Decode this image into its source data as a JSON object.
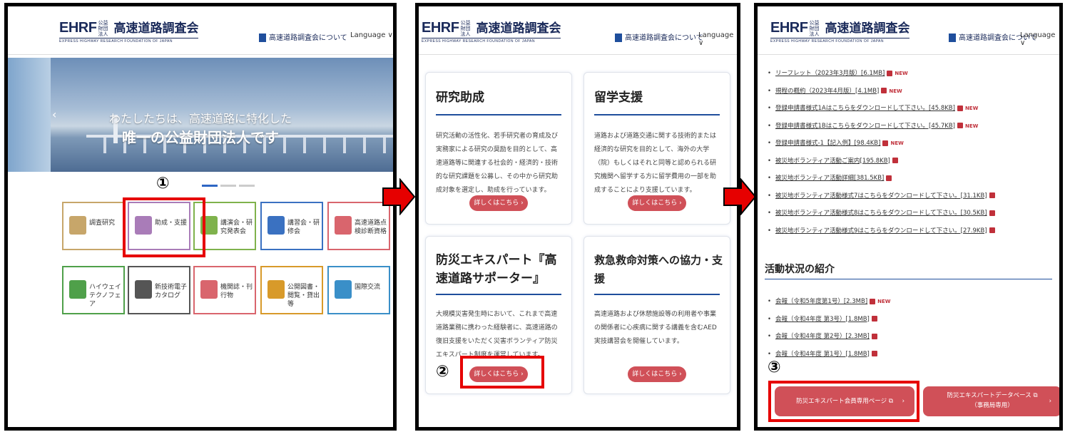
{
  "header": {
    "logo_main": "EHRF",
    "logo_corp": "公益 財団法人",
    "logo_jp": "高速道路調査会",
    "logo_en": "EXPRESS HIGHWAY RESEARCH FOUNDATION OF JAPAN",
    "about_link": "高速道路調査会について",
    "language": "Language ∨"
  },
  "hero": {
    "line1": "わたしたちは、高速道路に特化した",
    "line2": "唯一の公益財団法人です"
  },
  "tiles": [
    {
      "label": "調査研究",
      "color": "#c7a66a"
    },
    {
      "label": "助成・支援",
      "color": "#a97cb8"
    },
    {
      "label": "講演会・研究発表会",
      "color": "#7fb24c"
    },
    {
      "label": "講習会・研修会",
      "color": "#3a71c1"
    },
    {
      "label": "高速道路点検診断資格",
      "color": "#d9656d"
    },
    {
      "label": "ハイウェイテクノフェア",
      "color": "#4fa04a"
    },
    {
      "label": "新技術電子カタログ",
      "color": "#555555"
    },
    {
      "label": "機関誌・刊行物",
      "color": "#d9656d"
    },
    {
      "label": "公開図書・閲覧・貸出等",
      "color": "#d89a2a"
    },
    {
      "label": "国際交流",
      "color": "#3a8fc8"
    }
  ],
  "steps": {
    "one": "①",
    "two": "②",
    "three": "③"
  },
  "cards": [
    {
      "title": "研究助成",
      "text": "研究活動の活性化、若手研究者の育成及び実務家による研究の奨励を目的として、高速道路等に関連する社会的・経済的・技術的な研究課題を公募し、その中から研究助成対象を選定し、助成を行っています。",
      "button": "詳しくはこちら ›"
    },
    {
      "title": "留学支援",
      "text": "道路および道路交通に関する技術的または経済的な研究を目的として、海外の大学（院）もしくはそれと同等と認められる研究機関へ留学する方に留学費用の一部を助成することにより支援しています。",
      "button": "詳しくはこちら ›"
    },
    {
      "title": "防災エキスパート『高速道路サポーター』",
      "text": "大規模災害発生時において、これまで高速道路業務に携わった経験者に、高速道路の復旧支援をいただく災害ボランティア防災エキスパート制度を運営しています。",
      "button": "詳しくはこちら ›"
    },
    {
      "title": "救急救命対策への協力・支援",
      "text": "高速道路および休憩施設等の利用者や事業の関係者に心疾病に関する講義を含むAED実技講習会を開催しています。",
      "button": "詳しくはこちら ›"
    }
  ],
  "downloads": [
    {
      "text": "リーフレット（2023年3月版）[6.1MB]",
      "new": "NEW"
    },
    {
      "text": "規程の概約（2023年4月版）[4.1MB]",
      "new": "NEW"
    },
    {
      "text": "登録申請書様式1Aはこちらをダウンロードして下さい。[45.8KB]",
      "new": "NEW"
    },
    {
      "text": "登録申請書様式1Bはこちらをダウンロードして下さい。[45.7KB]",
      "new": "NEW"
    },
    {
      "text": "登録申請書様式-1【記入例】[98.4KB]",
      "new": "NEW"
    },
    {
      "text": "被災地ボランティア活動ご案内[195.8KB]",
      "new": ""
    },
    {
      "text": "被災地ボランティア活動詳細[381.5KB]",
      "new": ""
    },
    {
      "text": "被災地ボランティア活動様式7はこちらをダウンロードして下さい。[31.1KB]",
      "new": ""
    },
    {
      "text": "被災地ボランティア活動様式8はこちらをダウンロードして下さい。[30.5KB]",
      "new": ""
    },
    {
      "text": "被災地ボランティア活動様式9はこちらをダウンロードして下さい。[27.9KB]",
      "new": ""
    }
  ],
  "activity": {
    "title": "活動状況の紹介",
    "items": [
      {
        "text": "会報（令和5年度第1号）[2.3MB]",
        "new": "NEW"
      },
      {
        "text": "会報（令和4年度 第3号）[1.8MB]",
        "new": ""
      },
      {
        "text": "会報（令和4年度 第2号）[2.3MB]",
        "new": ""
      },
      {
        "text": "会報（令和4年度 第1号）[1.8MB]",
        "new": ""
      }
    ]
  },
  "bottom_buttons": {
    "members": "防災エキスパート会員専用ページ",
    "database": "防災エキスパートデータベース",
    "database_sub": "（事務局専用）"
  }
}
